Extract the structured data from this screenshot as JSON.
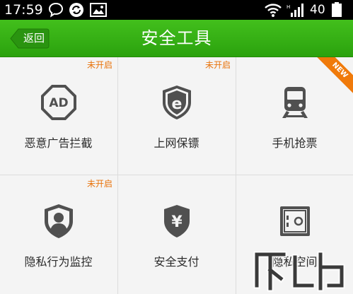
{
  "status_bar": {
    "time": "17:59",
    "battery_level": "40",
    "icons": [
      "chat-icon",
      "sync-icon",
      "image-icon",
      "wifi-icon",
      "signal-icon",
      "battery-icon"
    ]
  },
  "header": {
    "back_label": "返回",
    "title": "安全工具"
  },
  "colors": {
    "header_green": "#35b016",
    "status_orange": "#e8730b",
    "icon_gray": "#505050"
  },
  "tools": [
    {
      "label": "恶意广告拦截",
      "status": "未开启",
      "icon": "ad-block-icon"
    },
    {
      "label": "上网保镖",
      "status": "未开启",
      "icon": "browser-shield-icon"
    },
    {
      "label": "手机抢票",
      "status": "",
      "badge": "NEW",
      "icon": "train-icon"
    },
    {
      "label": "隐私行为监控",
      "status": "未开启",
      "icon": "privacy-shield-icon"
    },
    {
      "label": "安全支付",
      "status": "",
      "icon": "yuan-shield-icon"
    },
    {
      "label": "隐私空间",
      "status": "",
      "icon": "safe-icon"
    }
  ]
}
